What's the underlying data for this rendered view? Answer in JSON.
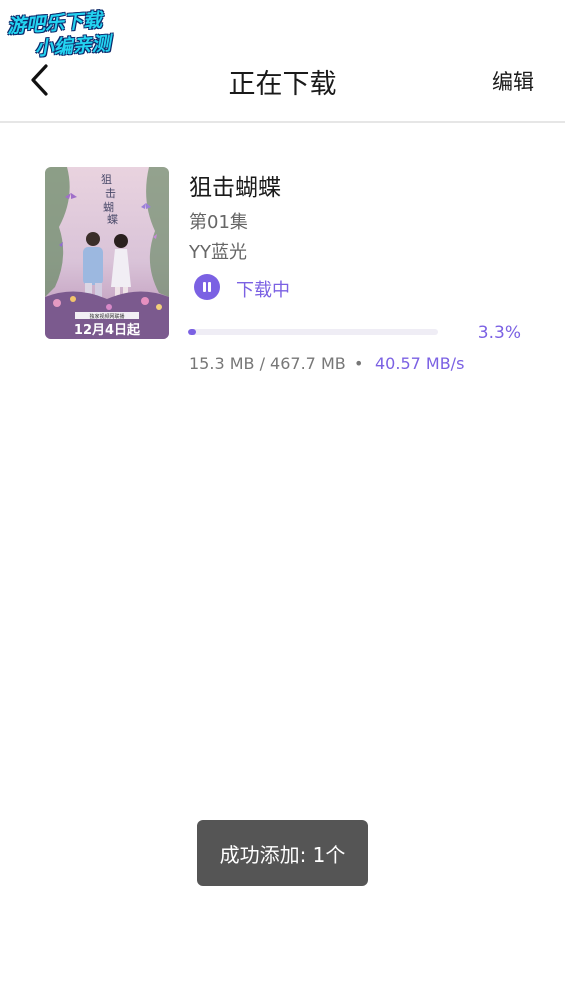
{
  "watermark": {
    "line1": "游吧乐下载",
    "line2": "小编亲测"
  },
  "header": {
    "title": "正在下载",
    "edit_label": "编辑",
    "back_icon": "chevron-left-icon"
  },
  "downloads": [
    {
      "title": "狙击蝴蝶",
      "episode": "第01集",
      "quality": "YY蓝光",
      "status": "下载中",
      "progress_percent": 3.3,
      "progress_label": "3.3%",
      "size_text": "15.3 MB / 467.7 MB",
      "separator": "•",
      "speed": "40.57 MB/s",
      "poster": {
        "date_label": "12月4日起",
        "banner_label": "独家视频网联播",
        "title_vertical": "狙击蝴蝶"
      }
    }
  ],
  "toast": {
    "message": "成功添加: 1个"
  },
  "colors": {
    "accent": "#7b61e3",
    "text_primary": "#1a1a1a",
    "text_secondary": "#666666",
    "toast_bg": "#555555",
    "divider": "#e6e6e6"
  }
}
